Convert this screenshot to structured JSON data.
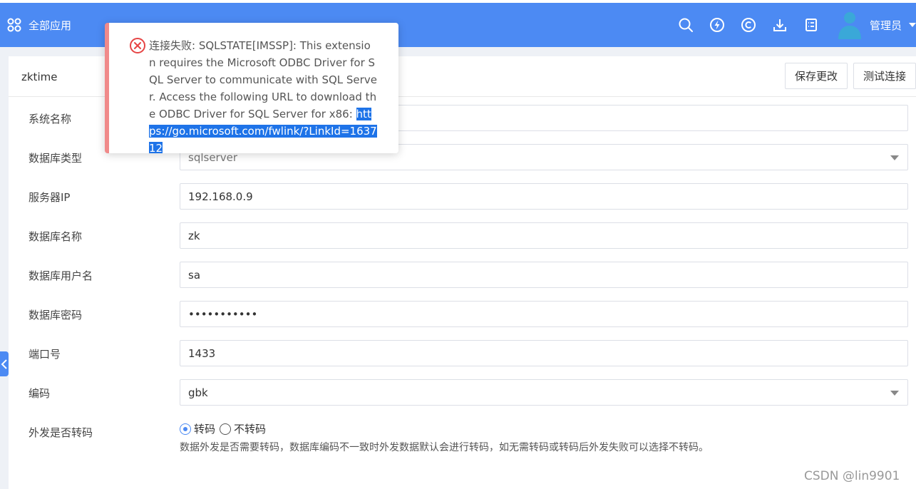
{
  "topbar": {
    "apps_label": "全部应用",
    "user_name": "管理员",
    "icons": [
      "search-icon",
      "lightning-icon",
      "copyright-icon",
      "download-icon",
      "checklist-icon"
    ]
  },
  "panel": {
    "title": "zktime",
    "save_label": "保存更改",
    "test_label": "测试连接"
  },
  "form": {
    "system_name_label": "系统名称",
    "system_name_value": "",
    "db_type_label": "数据库类型",
    "db_type_value": "sqlserver",
    "server_ip_label": "服务器IP",
    "server_ip_value": "192.168.0.9",
    "db_name_label": "数据库名称",
    "db_name_value": "zk",
    "db_user_label": "数据库用户名",
    "db_user_value": "sa",
    "db_pass_label": "数据库密码",
    "db_pass_value": "•••••••••••",
    "port_label": "端口号",
    "port_value": "1433",
    "encoding_label": "编码",
    "encoding_value": "gbk",
    "transcode_label": "外发是否转码",
    "transcode_options": [
      "转码",
      "不转码"
    ],
    "transcode_selected": "转码",
    "transcode_hint": "数据外发是否需要转码，数据库编码不一致时外发数据默认会进行转码，如无需转码或转码后外发失败可以选择不转码。"
  },
  "toast": {
    "message": "连接失败: SQLSTATE[IMSSP]: This extension requires the Microsoft ODBC Driver for SQL Server to communicate with SQL Server. Access the following URL to download the ODBC Driver for SQL Server for x86: ",
    "link": "https://go.microsoft.com/fwlink/?LinkId=163712"
  },
  "watermark": "CSDN @lin9901",
  "colors": {
    "brand": "#4c8af3",
    "error": "#e64545",
    "selection": "#1e73e8"
  }
}
